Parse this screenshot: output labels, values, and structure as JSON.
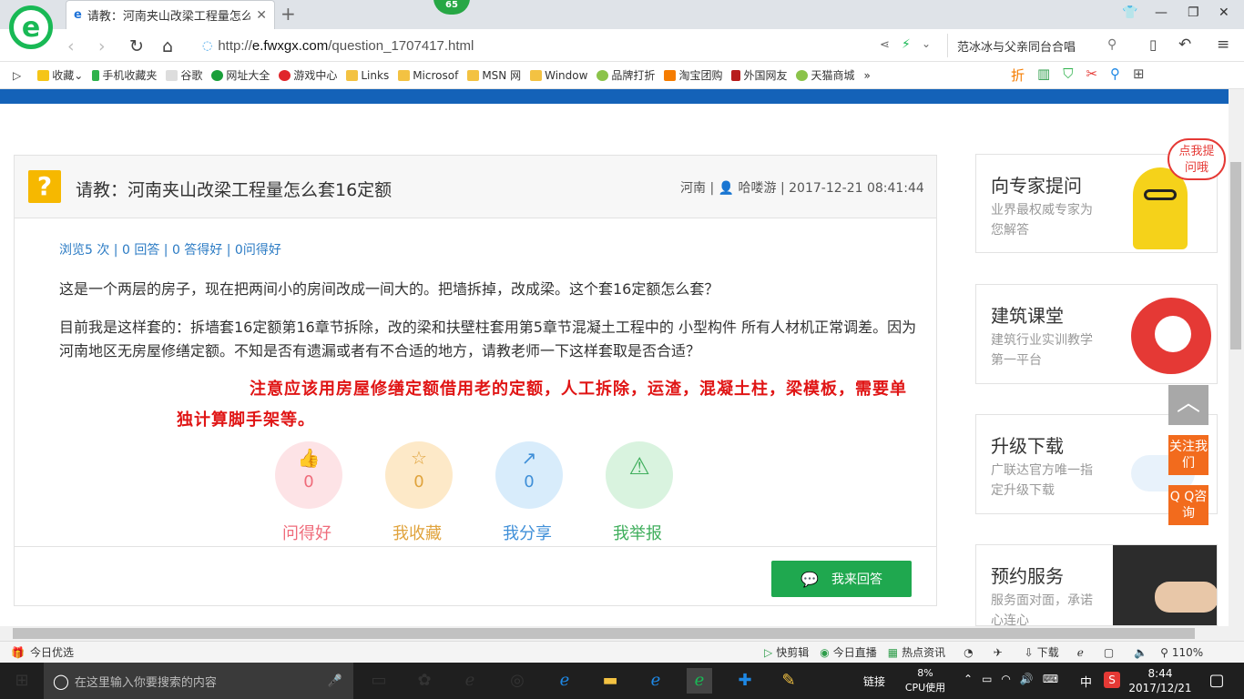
{
  "browser": {
    "badge": "65",
    "tab_title": "请教：河南夹山改梁工程量怎么套",
    "url_prefix": "http://",
    "url_host": "e.fwxgx.com",
    "url_path": "/question_1707417.html",
    "search_text": "范冰冰与父亲同台合唱",
    "bookmarks": [
      "收藏",
      "手机收藏夹",
      "谷歌",
      "网址大全",
      "游戏中心",
      "Links",
      "Microsof",
      "MSN 网",
      "Window",
      "品牌打折",
      "淘宝团购",
      "外国网友",
      "天猫商城"
    ],
    "more": "»"
  },
  "question": {
    "title": "请教：河南夹山改梁工程量怎么套16定额",
    "region": "河南",
    "user": "哈喽游",
    "datetime": "2017-12-21 08:41:44",
    "stats": "浏览5 次 | 0 回答 | 0 答得好 | 0问得好",
    "body1": "这是一个两层的房子，现在把两间小的房间改成一间大的。把墙拆掉，改成梁。这个套16定额怎么套？",
    "body2": "目前我是这样套的：拆墙套16定额第16章节拆除，改的梁和扶壁柱套用第5章节混凝土工程中的 小型构件 所有人材机正常调差。因为河南地区无房屋修缮定额。不知是否有遗漏或者有不合适的地方，请教老师一下这样套取是否合适？",
    "note": "注意应该用房屋修缮定额借用老的定额，人工拆除，运渣，混凝土柱，梁模板，需要单独计算脚手架等。"
  },
  "actions": [
    {
      "label": "问得好",
      "count": "0",
      "color": "#ef6b7a",
      "bg": "#fde3e6",
      "icon": "thumbs-up-icon",
      "glyph": "👍"
    },
    {
      "label": "我收藏",
      "count": "0",
      "color": "#e0a33c",
      "bg": "#fde9c8",
      "icon": "star-icon",
      "glyph": "☆"
    },
    {
      "label": "我分享",
      "count": "0",
      "color": "#3f8fd8",
      "bg": "#d8ecfb",
      "icon": "share-icon",
      "glyph": "↗"
    },
    {
      "label": "我举报",
      "count": "",
      "color": "#3fae5c",
      "bg": "#d9f3df",
      "icon": "warning-icon",
      "glyph": "⚠"
    }
  ],
  "answer_button": "我来回答",
  "sidebar": [
    {
      "title": "向专家提问",
      "desc": "业界最权威专家为您解答"
    },
    {
      "title": "建筑课堂",
      "desc": "建筑行业实训教学第一平台"
    },
    {
      "title": "升级下载",
      "desc": "广联达官方唯一指定升级下载"
    },
    {
      "title": "预约服务",
      "desc": "服务面对面，承诺心连心"
    }
  ],
  "bubble": "点我提问哦",
  "float_follow": "关注我们",
  "float_qq": "Q Q咨询",
  "status": {
    "left": "今日优选",
    "items": [
      "快剪辑",
      "今日直播",
      "热点资讯"
    ],
    "download": "下载",
    "zoom": "110%"
  },
  "taskbar": {
    "search_placeholder": "在这里输入你要搜索的内容",
    "network": "链接",
    "cpu_pct": "8%",
    "cpu_label": "CPU使用",
    "ime": "中",
    "time": "8:44",
    "date": "2017/12/21"
  }
}
